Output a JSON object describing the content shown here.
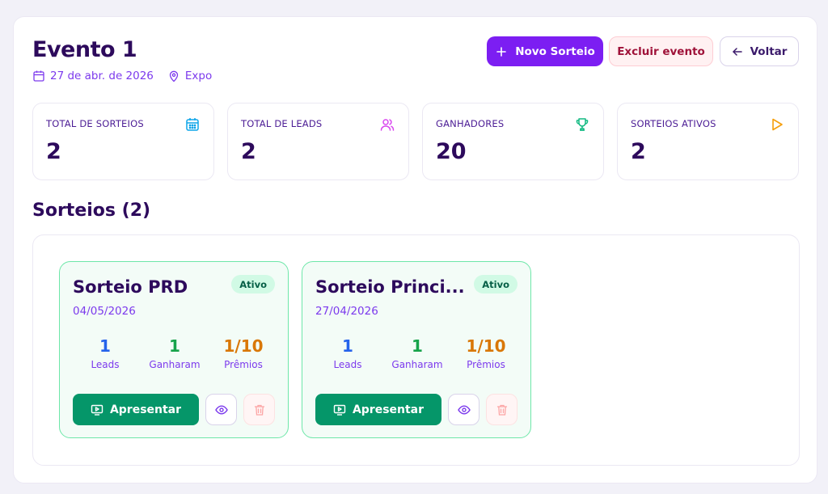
{
  "event": {
    "title": "Evento 1",
    "date": "27 de abr. de 2026",
    "location": "Expo"
  },
  "actions": {
    "new_draw": "Novo Sorteio",
    "delete_event": "Excluir evento",
    "back": "Voltar"
  },
  "stats": [
    {
      "label": "TOTAL DE SORTEIOS",
      "value": "2",
      "icon": "calendar-icon",
      "color": "#0ea5e9"
    },
    {
      "label": "TOTAL DE LEADS",
      "value": "2",
      "icon": "users-icon",
      "color": "#d946ef"
    },
    {
      "label": "GANHADORES",
      "value": "20",
      "icon": "trophy-icon",
      "color": "#10b981"
    },
    {
      "label": "SORTEIOS ATIVOS",
      "value": "2",
      "icon": "play-icon",
      "color": "#f59e0b"
    }
  ],
  "draws_section": {
    "title": "Sorteios (2)"
  },
  "draws": [
    {
      "title": "Sorteio PRD",
      "status": "Ativo",
      "date": "04/05/2026",
      "leads_value": "1",
      "leads_label": "Leads",
      "winners_value": "1",
      "winners_label": "Ganharam",
      "prizes_value": "1/10",
      "prizes_label": "Prêmios",
      "present_label": "Apresentar"
    },
    {
      "title": "Sorteio Princi...",
      "status": "Ativo",
      "date": "27/04/2026",
      "leads_value": "1",
      "leads_label": "Leads",
      "winners_value": "1",
      "winners_label": "Ganharam",
      "prizes_value": "1/10",
      "prizes_label": "Prêmios",
      "present_label": "Apresentar"
    }
  ],
  "colors": {
    "primary": "#7c1ef2",
    "heading": "#2d0a5c",
    "accent_text": "#7c3aed",
    "success": "#059669"
  }
}
